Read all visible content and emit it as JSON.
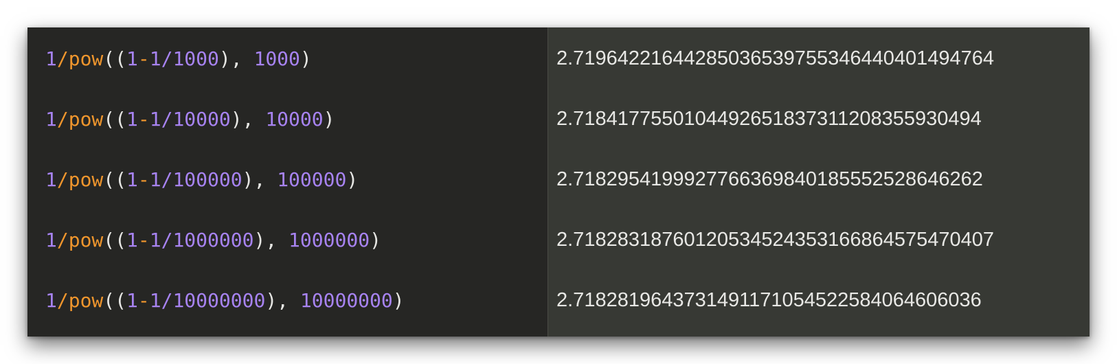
{
  "colors": {
    "number": "#a783f1",
    "function": "#f0962d",
    "punctuation": "#e6e6e3",
    "result_text": "#e8e8e5",
    "left_background": "#262624",
    "right_background": "#373934"
  },
  "rows": [
    {
      "one": "1",
      "slash": "/",
      "func": "pow",
      "open": "((",
      "base_one": "1",
      "minus": "-",
      "div_one": "1",
      "div_slash": "/",
      "n": "1000",
      "close_sep": "), ",
      "exp": "1000",
      "close": ")",
      "result": "2.71964221644285036539755346440401494764"
    },
    {
      "one": "1",
      "slash": "/",
      "func": "pow",
      "open": "((",
      "base_one": "1",
      "minus": "-",
      "div_one": "1",
      "div_slash": "/",
      "n": "10000",
      "close_sep": "), ",
      "exp": "10000",
      "close": ")",
      "result": "2.7184177550104492651837311208355930494"
    },
    {
      "one": "1",
      "slash": "/",
      "func": "pow",
      "open": "((",
      "base_one": "1",
      "minus": "-",
      "div_one": "1",
      "div_slash": "/",
      "n": "100000",
      "close_sep": "), ",
      "exp": "100000",
      "close": ")",
      "result": "2.7182954199927766369840185552528646262"
    },
    {
      "one": "1",
      "slash": "/",
      "func": "pow",
      "open": "((",
      "base_one": "1",
      "minus": "-",
      "div_one": "1",
      "div_slash": "/",
      "n": "1000000",
      "close_sep": "), ",
      "exp": "1000000",
      "close": ")",
      "result": "2.71828318760120534524353166864575470407"
    },
    {
      "one": "1",
      "slash": "/",
      "func": "pow",
      "open": "((",
      "base_one": "1",
      "minus": "-",
      "div_one": "1",
      "div_slash": "/",
      "n": "10000000",
      "close_sep": "), ",
      "exp": "10000000",
      "close": ")",
      "result": "2.7182819643731491171054522584064606036"
    }
  ]
}
